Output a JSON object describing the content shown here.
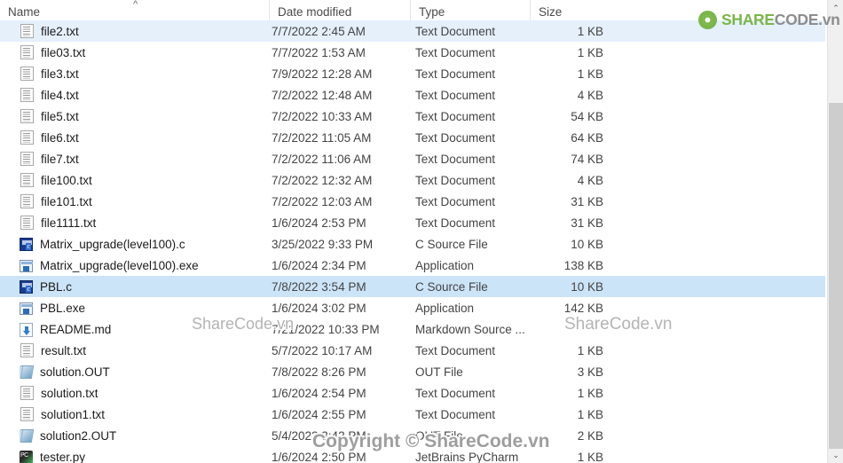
{
  "columns": {
    "name": "Name",
    "date_modified": "Date modified",
    "type": "Type",
    "size": "Size",
    "sort_indicator": "^"
  },
  "rows": [
    {
      "name": "file2.txt",
      "date": "7/7/2022 2:45 AM",
      "type": "Text Document",
      "size": "1 KB",
      "icon": "text-document-icon",
      "state": "hovered"
    },
    {
      "name": "file03.txt",
      "date": "7/7/2022 1:53 AM",
      "type": "Text Document",
      "size": "1 KB",
      "icon": "text-document-icon",
      "state": "normal"
    },
    {
      "name": "file3.txt",
      "date": "7/9/2022 12:28 AM",
      "type": "Text Document",
      "size": "1 KB",
      "icon": "text-document-icon",
      "state": "normal"
    },
    {
      "name": "file4.txt",
      "date": "7/2/2022 12:48 AM",
      "type": "Text Document",
      "size": "4 KB",
      "icon": "text-document-icon",
      "state": "normal"
    },
    {
      "name": "file5.txt",
      "date": "7/2/2022 10:33 AM",
      "type": "Text Document",
      "size": "54 KB",
      "icon": "text-document-icon",
      "state": "normal"
    },
    {
      "name": "file6.txt",
      "date": "7/2/2022 11:05 AM",
      "type": "Text Document",
      "size": "64 KB",
      "icon": "text-document-icon",
      "state": "normal"
    },
    {
      "name": "file7.txt",
      "date": "7/2/2022 11:06 AM",
      "type": "Text Document",
      "size": "74 KB",
      "icon": "text-document-icon",
      "state": "normal"
    },
    {
      "name": "file100.txt",
      "date": "7/2/2022 12:32 AM",
      "type": "Text Document",
      "size": "4 KB",
      "icon": "text-document-icon",
      "state": "normal"
    },
    {
      "name": "file101.txt",
      "date": "7/2/2022 12:03 AM",
      "type": "Text Document",
      "size": "31 KB",
      "icon": "text-document-icon",
      "state": "normal"
    },
    {
      "name": "file1111.txt",
      "date": "1/6/2024 2:53 PM",
      "type": "Text Document",
      "size": "31 KB",
      "icon": "text-document-icon",
      "state": "normal"
    },
    {
      "name": "Matrix_upgrade(level100).c",
      "date": "3/25/2022 9:33 PM",
      "type": "C Source File",
      "size": "10 KB",
      "icon": "c-source-file-icon",
      "state": "normal"
    },
    {
      "name": "Matrix_upgrade(level100).exe",
      "date": "1/6/2024 2:34 PM",
      "type": "Application",
      "size": "138 KB",
      "icon": "application-exe-icon",
      "state": "normal"
    },
    {
      "name": "PBL.c",
      "date": "7/8/2022 3:54 PM",
      "type": "C Source File",
      "size": "10 KB",
      "icon": "c-source-file-icon",
      "state": "selected"
    },
    {
      "name": "PBL.exe",
      "date": "1/6/2024 3:02 PM",
      "type": "Application",
      "size": "142 KB",
      "icon": "application-exe-icon",
      "state": "normal"
    },
    {
      "name": "README.md",
      "date": "7/21/2022 10:33 PM",
      "type": "Markdown Source ...",
      "size": "",
      "icon": "markdown-source-icon",
      "state": "normal"
    },
    {
      "name": "result.txt",
      "date": "5/7/2022 10:17 AM",
      "type": "Text Document",
      "size": "1 KB",
      "icon": "text-document-icon",
      "state": "normal"
    },
    {
      "name": "solution.OUT",
      "date": "7/8/2022 8:26 PM",
      "type": "OUT File",
      "size": "3 KB",
      "icon": "out-file-icon",
      "state": "normal"
    },
    {
      "name": "solution.txt",
      "date": "1/6/2024 2:54 PM",
      "type": "Text Document",
      "size": "1 KB",
      "icon": "text-document-icon",
      "state": "normal"
    },
    {
      "name": "solution1.txt",
      "date": "1/6/2024 2:55 PM",
      "type": "Text Document",
      "size": "1 KB",
      "icon": "text-document-icon",
      "state": "normal"
    },
    {
      "name": "solution2.OUT",
      "date": "5/4/2022 3:42 PM",
      "type": "OUT File",
      "size": "2 KB",
      "icon": "out-file-icon",
      "state": "normal"
    },
    {
      "name": "tester.py",
      "date": "1/6/2024 2:50 PM",
      "type": "JetBrains PyCharm",
      "size": "1 KB",
      "icon": "pycharm-python-icon",
      "state": "normal"
    }
  ],
  "logo": {
    "share": "SHARE",
    "code": "CODE",
    "vn": ".vn",
    "share_color": "#7ab648",
    "code_color": "#8d8d8d"
  },
  "watermarks": {
    "left": "ShareCode.vn",
    "right": "ShareCode.vn",
    "copyright": "Copyright © ShareCode.vn"
  },
  "scrollbar": {
    "up_arrow": "⌃",
    "down_arrow": "⌄"
  }
}
